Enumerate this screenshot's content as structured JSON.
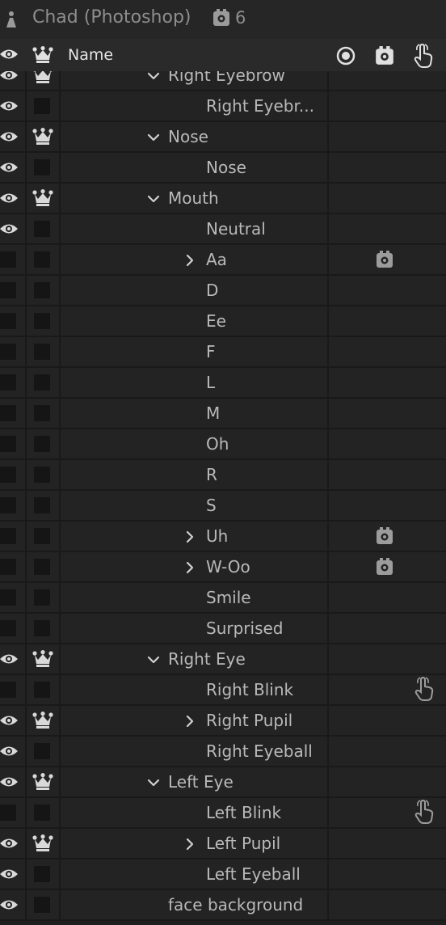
{
  "window": {
    "title": "Chad (Photoshop)",
    "trigger_count": "6"
  },
  "header": {
    "name_label": "Name",
    "icons": [
      "eye-icon",
      "crown-icon",
      "record-icon",
      "trigger-icon",
      "hand-icon"
    ]
  },
  "colors": {
    "background": "#1f1f1f",
    "row": "#232323",
    "text": "#b9b9b9",
    "icon": "#d9d9d9"
  },
  "layers": [
    {
      "label": "Right Eyebrow",
      "depth": 0,
      "twisty": "down",
      "eye": true,
      "crown": true
    },
    {
      "label": "Right Eyebr...",
      "depth": 1,
      "twisty": "none",
      "eye": true,
      "crown": false
    },
    {
      "label": "Nose",
      "depth": 0,
      "twisty": "down",
      "eye": true,
      "crown": true
    },
    {
      "label": "Nose",
      "depth": 1,
      "twisty": "none",
      "eye": true,
      "crown": false
    },
    {
      "label": "Mouth",
      "depth": 0,
      "twisty": "down",
      "eye": true,
      "crown": true
    },
    {
      "label": "Neutral",
      "depth": 1,
      "twisty": "none",
      "eye": true,
      "crown": false
    },
    {
      "label": "Aa",
      "depth": 1,
      "twisty": "right",
      "eye": false,
      "crown": false,
      "trigger": true
    },
    {
      "label": "D",
      "depth": 1,
      "twisty": "none",
      "eye": false,
      "crown": false
    },
    {
      "label": "Ee",
      "depth": 1,
      "twisty": "none",
      "eye": false,
      "crown": false
    },
    {
      "label": "F",
      "depth": 1,
      "twisty": "none",
      "eye": false,
      "crown": false
    },
    {
      "label": "L",
      "depth": 1,
      "twisty": "none",
      "eye": false,
      "crown": false
    },
    {
      "label": "M",
      "depth": 1,
      "twisty": "none",
      "eye": false,
      "crown": false
    },
    {
      "label": "Oh",
      "depth": 1,
      "twisty": "none",
      "eye": false,
      "crown": false
    },
    {
      "label": "R",
      "depth": 1,
      "twisty": "none",
      "eye": false,
      "crown": false
    },
    {
      "label": "S",
      "depth": 1,
      "twisty": "none",
      "eye": false,
      "crown": false
    },
    {
      "label": "Uh",
      "depth": 1,
      "twisty": "right",
      "eye": false,
      "crown": false,
      "trigger": true
    },
    {
      "label": "W-Oo",
      "depth": 1,
      "twisty": "right",
      "eye": false,
      "crown": false,
      "trigger": true
    },
    {
      "label": "Smile",
      "depth": 1,
      "twisty": "none",
      "eye": false,
      "crown": false
    },
    {
      "label": "Surprised",
      "depth": 1,
      "twisty": "none",
      "eye": false,
      "crown": false
    },
    {
      "label": "Right Eye",
      "depth": 0,
      "twisty": "down",
      "eye": true,
      "crown": true
    },
    {
      "label": "Right Blink",
      "depth": 1,
      "twisty": "none",
      "eye": false,
      "crown": false,
      "hand": true
    },
    {
      "label": "Right Pupil",
      "depth": 1,
      "twisty": "right",
      "eye": true,
      "crown": true
    },
    {
      "label": "Right Eyeball",
      "depth": 1,
      "twisty": "none",
      "eye": true,
      "crown": false
    },
    {
      "label": "Left Eye",
      "depth": 0,
      "twisty": "down",
      "eye": true,
      "crown": true
    },
    {
      "label": "Left Blink",
      "depth": 1,
      "twisty": "none",
      "eye": false,
      "crown": false,
      "hand": true
    },
    {
      "label": "Left Pupil",
      "depth": 1,
      "twisty": "right",
      "eye": true,
      "crown": true
    },
    {
      "label": "Left Eyeball",
      "depth": 1,
      "twisty": "none",
      "eye": true,
      "crown": false
    },
    {
      "label": "face background",
      "depth": 0,
      "twisty": "none",
      "eye": true,
      "crown": false
    }
  ]
}
